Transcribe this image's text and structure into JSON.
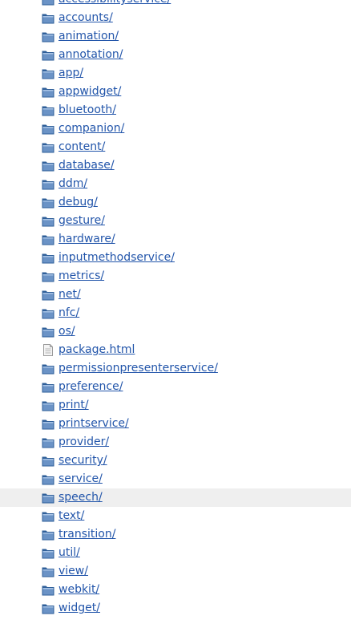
{
  "colors": {
    "link": "#2255aa",
    "row_highlight": "#efefef",
    "folder_fill": "#6b93c6",
    "folder_dark": "#2f5f99"
  },
  "entries": [
    {
      "name": "accessibilityservice/",
      "icon": "folder-icon"
    },
    {
      "name": "accounts/",
      "icon": "folder-icon"
    },
    {
      "name": "animation/",
      "icon": "folder-icon"
    },
    {
      "name": "annotation/",
      "icon": "folder-icon"
    },
    {
      "name": "app/",
      "icon": "folder-icon"
    },
    {
      "name": "appwidget/",
      "icon": "folder-icon"
    },
    {
      "name": "bluetooth/",
      "icon": "folder-icon"
    },
    {
      "name": "companion/",
      "icon": "folder-icon"
    },
    {
      "name": "content/",
      "icon": "folder-icon"
    },
    {
      "name": "database/",
      "icon": "folder-icon"
    },
    {
      "name": "ddm/",
      "icon": "folder-icon"
    },
    {
      "name": "debug/",
      "icon": "folder-icon"
    },
    {
      "name": "gesture/",
      "icon": "folder-icon"
    },
    {
      "name": "hardware/",
      "icon": "folder-icon"
    },
    {
      "name": "inputmethodservice/",
      "icon": "folder-icon"
    },
    {
      "name": "metrics/",
      "icon": "folder-icon"
    },
    {
      "name": "net/",
      "icon": "folder-icon"
    },
    {
      "name": "nfc/",
      "icon": "folder-icon"
    },
    {
      "name": "os/",
      "icon": "folder-icon"
    },
    {
      "name": "package.html",
      "icon": "file-icon"
    },
    {
      "name": "permissionpresenterservice/",
      "icon": "folder-icon"
    },
    {
      "name": "preference/",
      "icon": "folder-icon"
    },
    {
      "name": "print/",
      "icon": "folder-icon"
    },
    {
      "name": "printservice/",
      "icon": "folder-icon"
    },
    {
      "name": "provider/",
      "icon": "folder-icon"
    },
    {
      "name": "security/",
      "icon": "folder-icon"
    },
    {
      "name": "service/",
      "icon": "folder-icon"
    },
    {
      "name": "speech/",
      "icon": "folder-icon",
      "highlighted": true
    },
    {
      "name": "text/",
      "icon": "folder-icon"
    },
    {
      "name": "transition/",
      "icon": "folder-icon"
    },
    {
      "name": "util/",
      "icon": "folder-icon"
    },
    {
      "name": "view/",
      "icon": "folder-icon"
    },
    {
      "name": "webkit/",
      "icon": "folder-icon"
    },
    {
      "name": "widget/",
      "icon": "folder-icon"
    }
  ]
}
